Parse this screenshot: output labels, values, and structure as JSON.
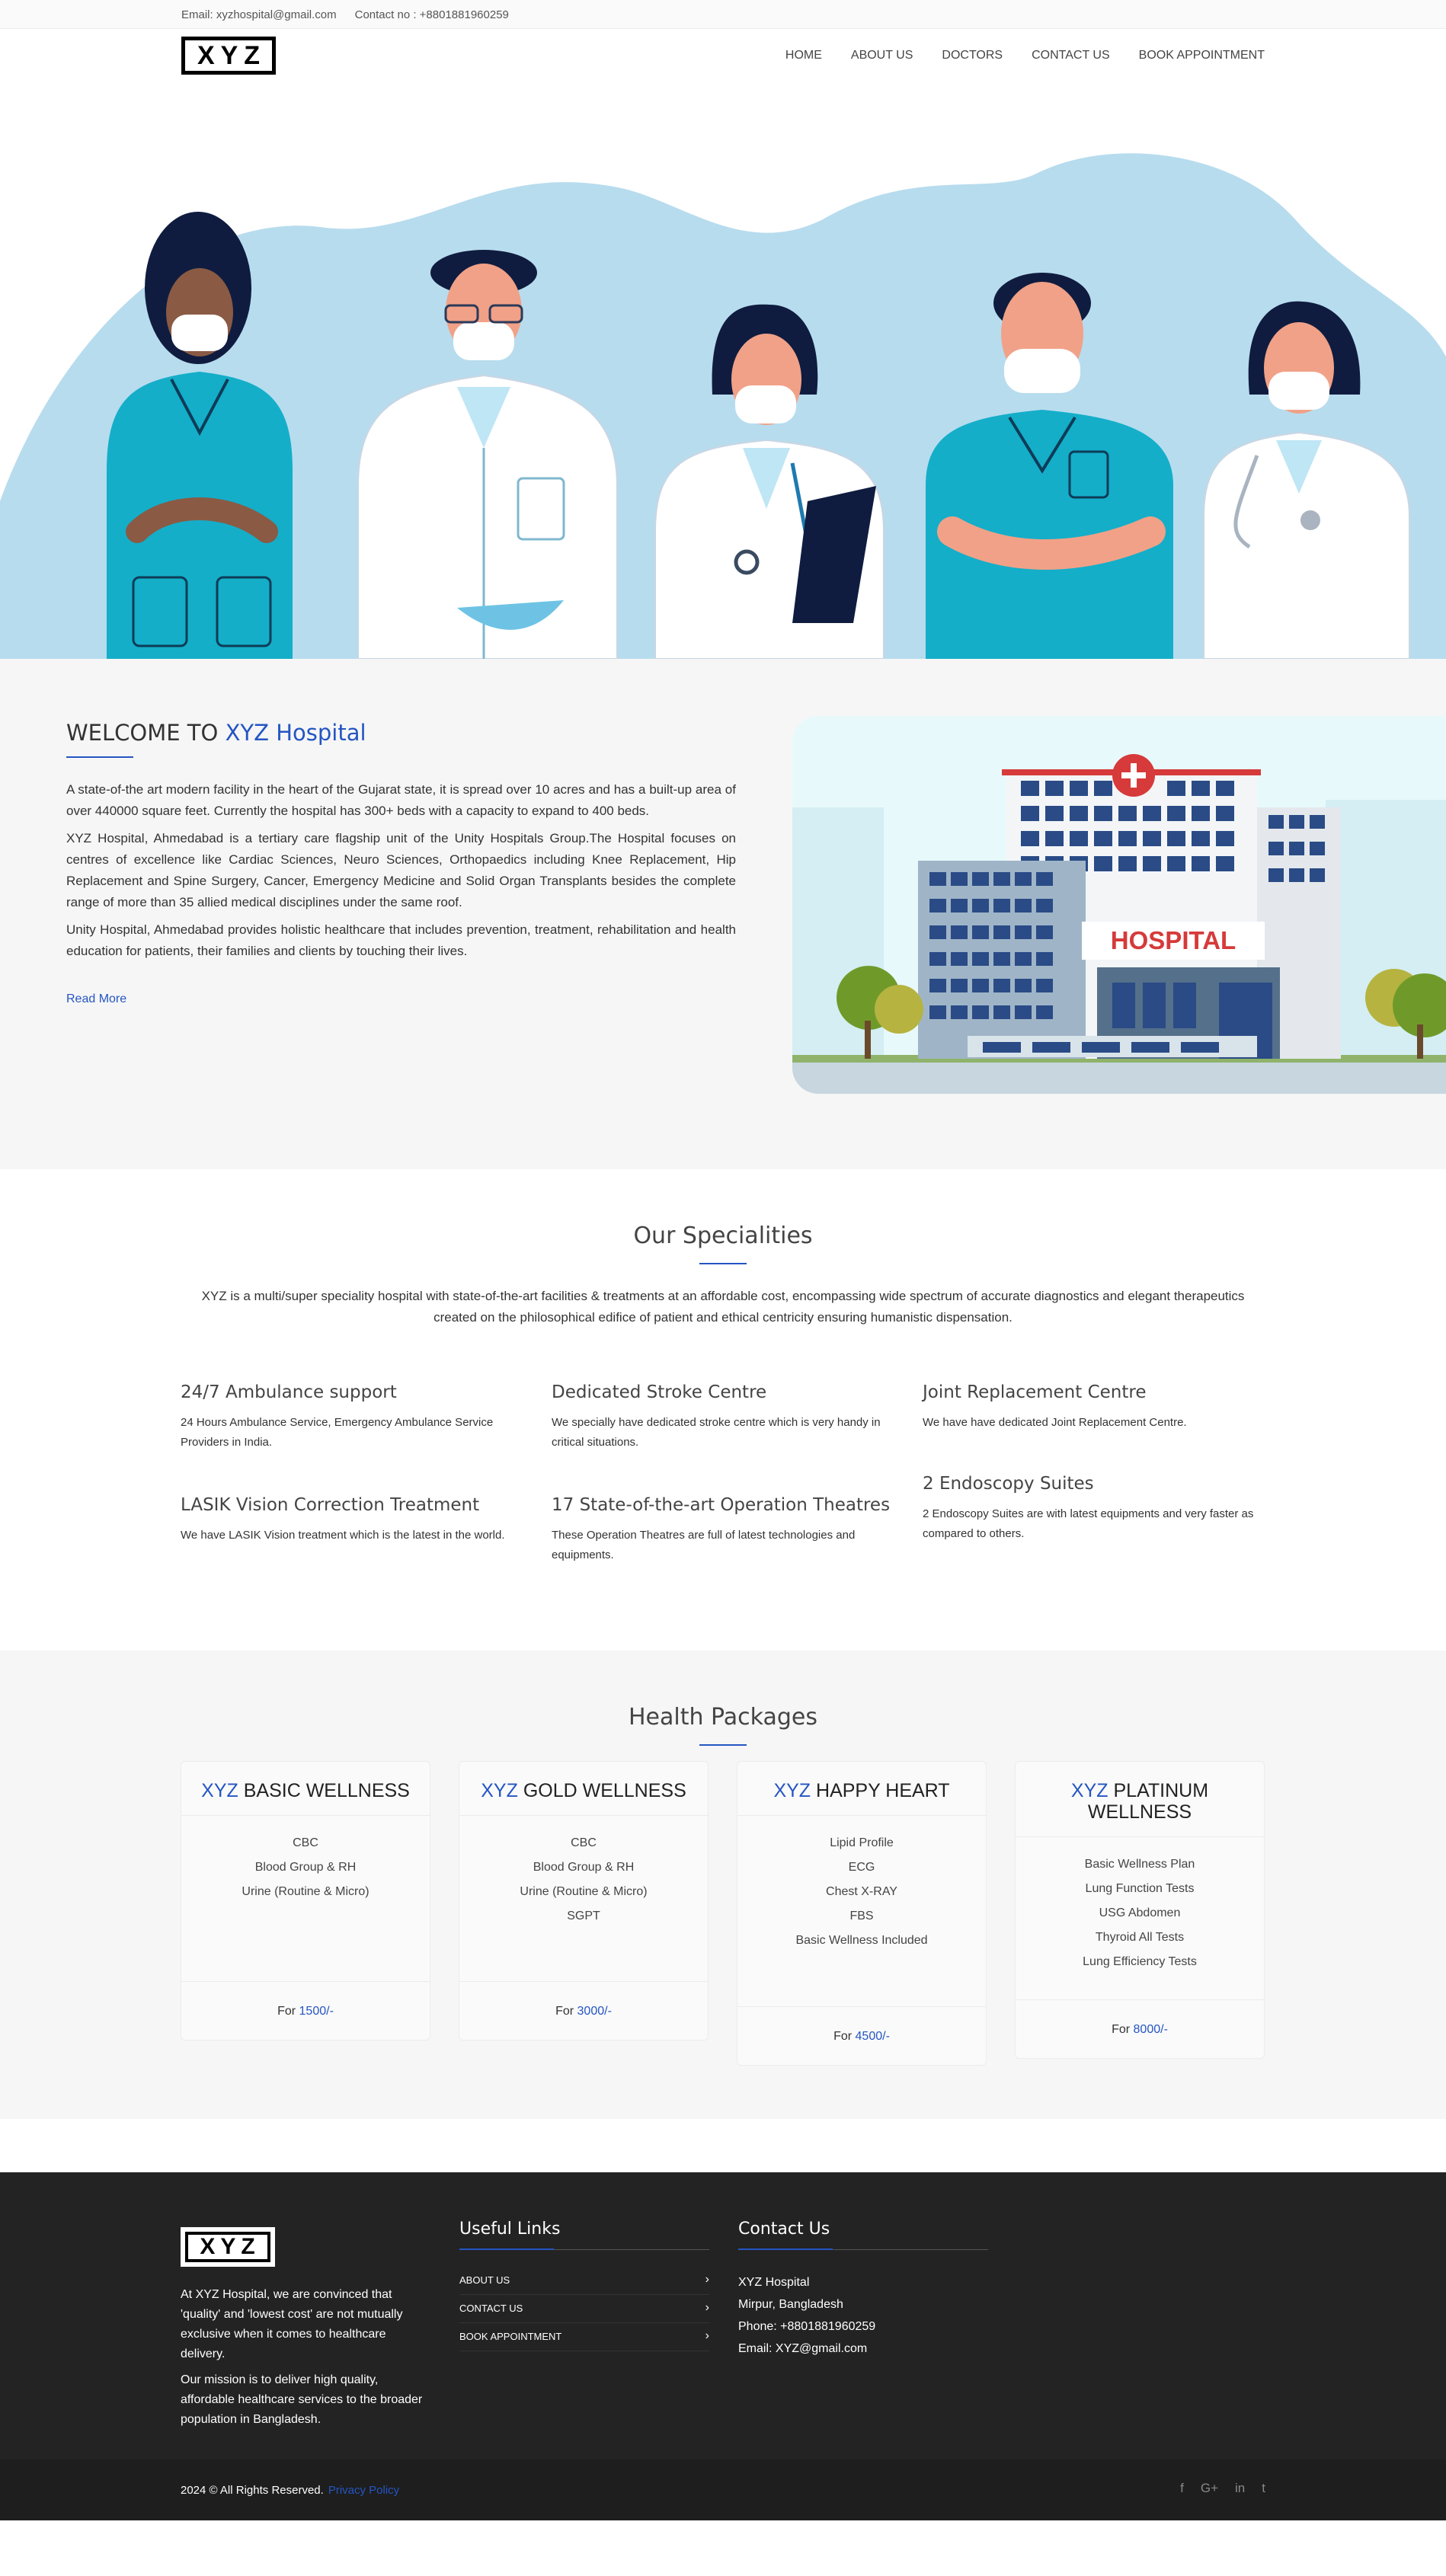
{
  "topbar": {
    "email": "Email: xyzhospital@gmail.com",
    "contact": "Contact no : +8801881960259"
  },
  "brand": {
    "logo_text": "XYZ"
  },
  "nav": {
    "items": [
      "HOME",
      "ABOUT US",
      "DOCTORS",
      "CONTACT US",
      "BOOK APPOINTMENT"
    ]
  },
  "welcome": {
    "title_prefix": "WELCOME TO",
    "title_accent": "XYZ Hospital",
    "paragraphs": [
      "A state-of-the art modern facility in the heart of the Gujarat state, it is spread over 10 acres and has a built-up area of over 440000 square feet. Currently the hospital has 300+ beds with a capacity to expand to 400 beds.",
      "XYZ Hospital, Ahmedabad is a tertiary care flagship unit of the Unity Hospitals Group.The Hospital focuses on centres of excellence like Cardiac Sciences, Neuro Sciences, Orthopaedics including Knee Replacement, Hip Replacement and Spine Surgery, Cancer, Emergency Medicine and Solid Organ Transplants besides the complete range of more than 35 allied medical disciplines under the same roof.",
      "Unity Hospital, Ahmedabad provides holistic healthcare that includes prevention, treatment, rehabilitation and health education for patients, their families and clients by touching their lives."
    ],
    "read_more": "Read More",
    "building_sign": "HOSPITAL"
  },
  "specialities": {
    "title": "Our Specialities",
    "intro": "XYZ is a multi/super speciality hospital with state-of-the-art facilities & treatments at an affordable cost, encompassing wide spectrum of accurate diagnostics and elegant therapeutics created on the philosophical edifice of patient and ethical centricity ensuring humanistic dispensation.",
    "items": [
      {
        "title": "24/7 Ambulance support",
        "desc": "24 Hours Ambulance Service, Emergency Ambulance Service Providers in India."
      },
      {
        "title": "Dedicated Stroke Centre",
        "desc": "We specially have dedicated stroke centre which is very handy in critical situations."
      },
      {
        "title": "Joint Replacement Centre",
        "desc": "We have have dedicated Joint Replacement Centre."
      },
      {
        "title": "LASIK Vision Correction Treatment",
        "desc": "We have LASIK Vision treatment which is the latest in the world."
      },
      {
        "title": "17 State-of-the-art Operation Theatres",
        "desc": "These Operation Theatres are full of latest technologies and equipments."
      },
      {
        "title": "2 Endoscopy Suites",
        "desc": "2 Endoscopy Suites are with latest equipments and very faster as compared to others."
      }
    ]
  },
  "packages": {
    "title": "Health Packages",
    "items": [
      {
        "brand": "XYZ",
        "name": "BASIC WELLNESS",
        "tests": [
          "CBC",
          "Blood Group & RH",
          "Urine (Routine & Micro)"
        ],
        "price_prefix": "For",
        "price": "1500/-"
      },
      {
        "brand": "XYZ",
        "name": "GOLD WELLNESS",
        "tests": [
          "CBC",
          "Blood Group & RH",
          "Urine (Routine & Micro)",
          "SGPT"
        ],
        "price_prefix": "For",
        "price": "3000/-"
      },
      {
        "brand": "XYZ",
        "name": "HAPPY HEART",
        "tests": [
          "Lipid Profile",
          "ECG",
          "Chest X-RAY",
          "FBS",
          "Basic Wellness Included"
        ],
        "price_prefix": "For",
        "price": "4500/-"
      },
      {
        "brand": "XYZ",
        "name": "PLATINUM WELLNESS",
        "tests": [
          "Basic Wellness Plan",
          "Lung Function Tests",
          "USG Abdomen",
          "Thyroid All Tests",
          "Lung Efficiency Tests"
        ],
        "price_prefix": "For",
        "price": "8000/-"
      }
    ]
  },
  "footer": {
    "about": [
      "At XYZ Hospital, we are convinced that 'quality' and 'lowest cost' are not mutually exclusive when it comes to healthcare delivery.",
      "Our mission is to deliver high quality, affordable healthcare services to the broader population in Bangladesh."
    ],
    "links_title": "Useful Links",
    "links": [
      "ABOUT US",
      "CONTACT US",
      "BOOK APPOINTMENT"
    ],
    "contact_title": "Contact Us",
    "contact": [
      "XYZ Hospital",
      "Mirpur, Bangladesh",
      "Phone: +8801881960259",
      "Email: XYZ@gmail.com"
    ],
    "copyright": "2024 © All Rights Reserved.",
    "privacy": "Privacy Policy",
    "social": [
      {
        "icon": "facebook-icon",
        "glyph": "f"
      },
      {
        "icon": "google-plus-icon",
        "glyph": "G+"
      },
      {
        "icon": "linkedin-icon",
        "glyph": "in"
      },
      {
        "icon": "twitter-icon",
        "glyph": "t"
      }
    ]
  },
  "colors": {
    "accent": "#2455c3",
    "footer_bg": "#232323",
    "scrub_teal": "#14aec9",
    "hero_blob": "#b7dcee"
  }
}
